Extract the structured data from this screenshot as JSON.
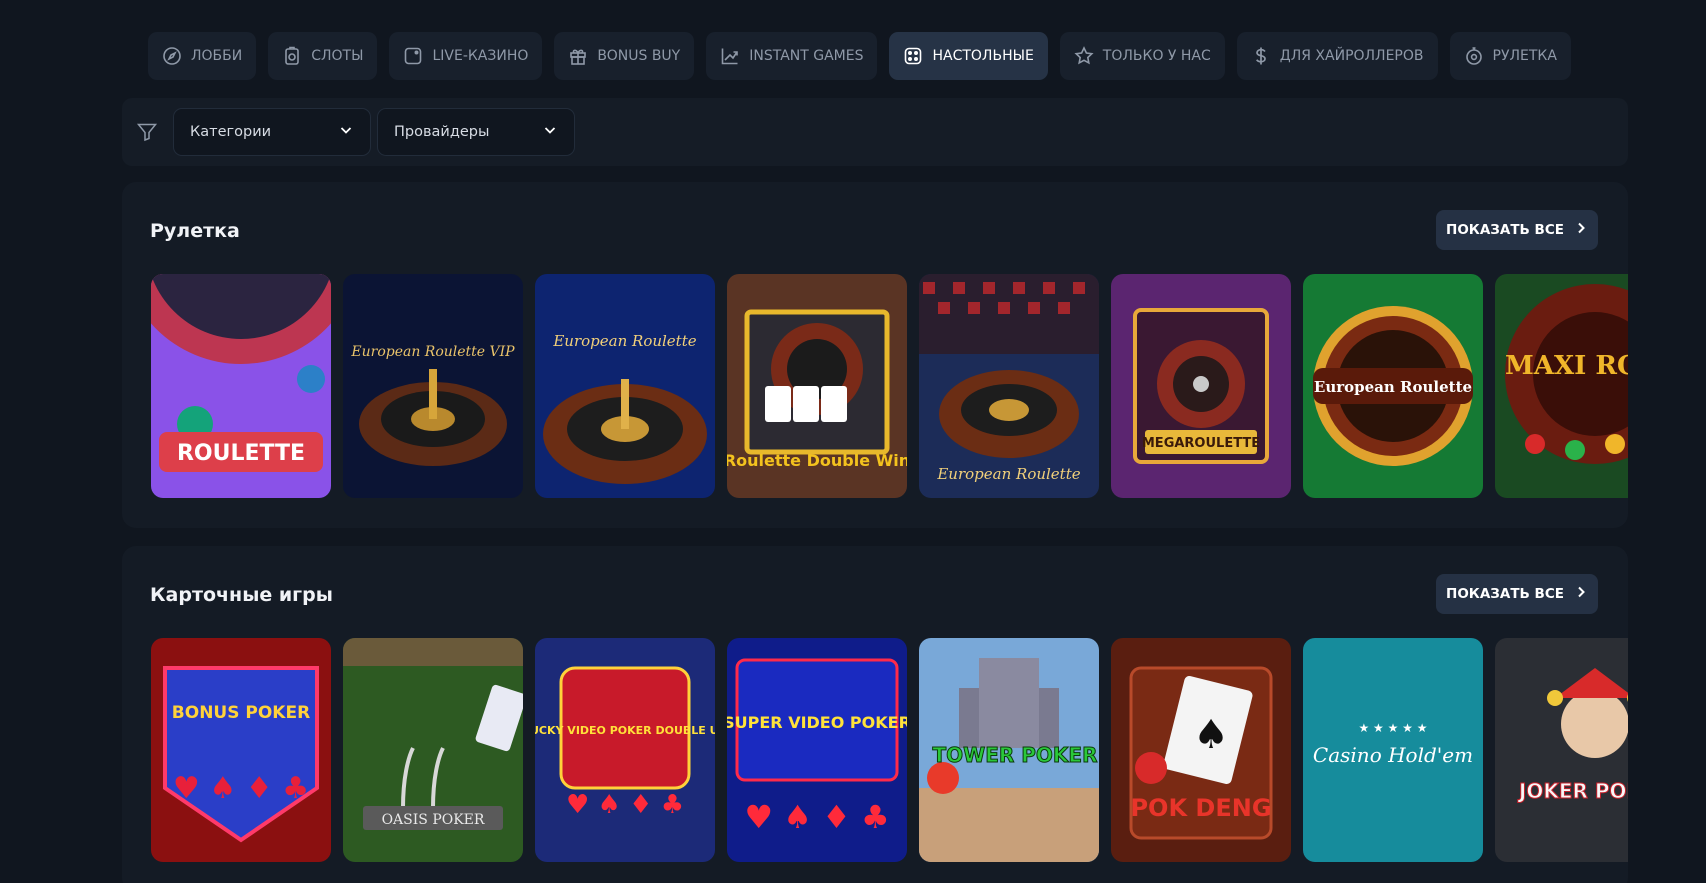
{
  "tabs": [
    {
      "label": "ЛОББИ",
      "icon": "compass-icon"
    },
    {
      "label": "СЛОТЫ",
      "icon": "slots-icon"
    },
    {
      "label": "LIVE-КАЗИНО",
      "icon": "live-casino-icon"
    },
    {
      "label": "BONUS BUY",
      "icon": "gift-icon"
    },
    {
      "label": "INSTANT GAMES",
      "icon": "chart-icon"
    },
    {
      "label": "НАСТОЛЬНЫЕ",
      "icon": "dice-icon",
      "active": true
    },
    {
      "label": "ТОЛЬКО У НАС",
      "icon": "star-icon"
    },
    {
      "label": "ДЛЯ ХАЙРОЛЛЕРОВ",
      "icon": "dollar-icon"
    },
    {
      "label": "РУЛЕТКА",
      "icon": "roulette-icon"
    }
  ],
  "filters": {
    "categories": "Категории",
    "providers": "Провайдеры"
  },
  "sections": {
    "roulette": {
      "title": "Рулетка",
      "show_all": "ПОКАЗАТЬ ВСЕ",
      "games": [
        {
          "title": "ROULETTE",
          "bg": "#8a52e8"
        },
        {
          "title": "European Roulette VIP",
          "bg": "#0b1434"
        },
        {
          "title": "European Roulette",
          "bg": "#0d2470"
        },
        {
          "title": "Roulette Double Win",
          "bg": "#5a3424"
        },
        {
          "title": "European Roulette",
          "bg": "#1c2c58"
        },
        {
          "title": "MEGAROULETTE",
          "bg": "#5b2570"
        },
        {
          "title": "European Roulette",
          "bg": "#157a34"
        },
        {
          "title": "MAXI ROULETTE",
          "bg": "#1a4a22"
        }
      ]
    },
    "cards": {
      "title": "Карточные игры",
      "show_all": "ПОКАЗАТЬ ВСЕ",
      "games": [
        {
          "title": "BONUS POKER",
          "bg": "#8b1010"
        },
        {
          "title": "OASIS POKER",
          "bg": "#2d5a22"
        },
        {
          "title": "LUCKY VIDEO POKER DOUBLE UP",
          "bg": "#1c2a78"
        },
        {
          "title": "SUPER VIDEO POKER",
          "bg": "#0f1c8a"
        },
        {
          "title": "TOWER POKER",
          "bg": "#79a8d8"
        },
        {
          "title": "POK DENG",
          "bg": "#5a1e10"
        },
        {
          "title": "Casino Hold'em",
          "bg": "#168c9c"
        },
        {
          "title": "JOKER POKER",
          "bg": "#2b2e34"
        }
      ]
    }
  }
}
